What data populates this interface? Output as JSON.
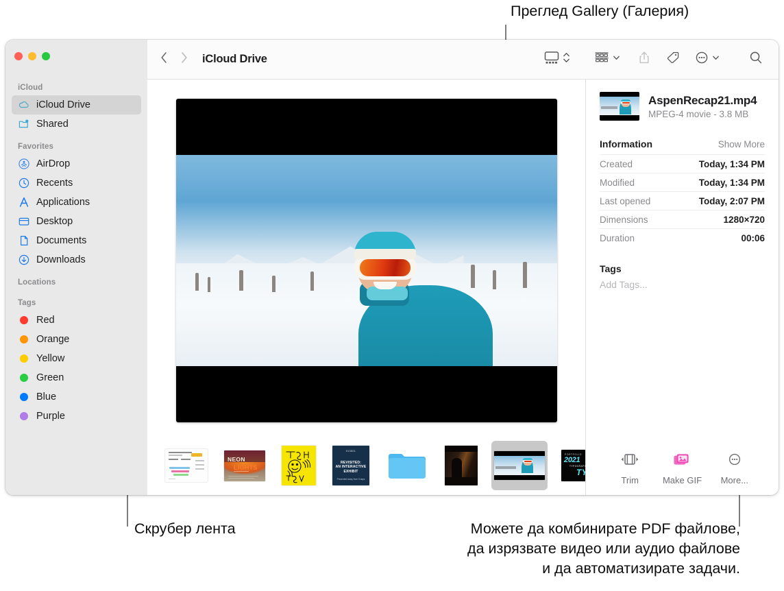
{
  "callouts": {
    "gallery": "Преглед Gallery (Галерия)",
    "scrubber": "Скрубер лента",
    "actions": "Можете да комбинирате PDF файлове,\nда изрязвате видео или аудио файлове\nи да автоматизирате задачи."
  },
  "window": {
    "traffic_lights": [
      "close",
      "minimize",
      "zoom"
    ]
  },
  "sidebar": {
    "groups": [
      {
        "title": "iCloud",
        "items": [
          {
            "label": "iCloud Drive",
            "icon": "cloud-icon",
            "selected": true
          },
          {
            "label": "Shared",
            "icon": "shared-folder-icon",
            "selected": false
          }
        ]
      },
      {
        "title": "Favorites",
        "items": [
          {
            "label": "AirDrop",
            "icon": "airdrop-icon",
            "selected": false
          },
          {
            "label": "Recents",
            "icon": "clock-icon",
            "selected": false
          },
          {
            "label": "Applications",
            "icon": "applications-icon",
            "selected": false
          },
          {
            "label": "Desktop",
            "icon": "desktop-icon",
            "selected": false
          },
          {
            "label": "Documents",
            "icon": "document-icon",
            "selected": false
          },
          {
            "label": "Downloads",
            "icon": "downloads-icon",
            "selected": false
          }
        ]
      },
      {
        "title": "Locations",
        "items": []
      },
      {
        "title": "Tags",
        "items": [
          {
            "label": "Red",
            "icon": "tag-dot-icon",
            "color": "#ff3b30"
          },
          {
            "label": "Orange",
            "icon": "tag-dot-icon",
            "color": "#ff9500"
          },
          {
            "label": "Yellow",
            "icon": "tag-dot-icon",
            "color": "#ffcc00"
          },
          {
            "label": "Green",
            "icon": "tag-dot-icon",
            "color": "#28cd41"
          },
          {
            "label": "Blue",
            "icon": "tag-dot-icon",
            "color": "#007aff"
          },
          {
            "label": "Purple",
            "icon": "tag-dot-icon",
            "color": "#af7ce8"
          }
        ]
      }
    ]
  },
  "toolbar": {
    "back": "back-icon",
    "forward": "forward-icon",
    "title": "iCloud Drive",
    "view_button": "gallery-view-icon",
    "group_button": "group-by-icon",
    "share_button": "share-icon",
    "tag_button": "tag-icon",
    "more_button": "more-actions-icon",
    "search_button": "search-icon"
  },
  "preview": {
    "alt": "Skier in teal jacket with white goggles on snowy mountain"
  },
  "scrubber": {
    "items": [
      {
        "name": "chart-document-thumbnail",
        "kind": "chart",
        "selected": false
      },
      {
        "name": "neon-lights-poster-thumbnail",
        "kind": "neon",
        "selected": false
      },
      {
        "name": "thank-you-poster-thumbnail",
        "kind": "thanks",
        "selected": false
      },
      {
        "name": "portfolio-exhibit-thumbnail",
        "kind": "portfolio",
        "selected": false
      },
      {
        "name": "folder-thumbnail",
        "kind": "folder",
        "selected": false
      },
      {
        "name": "dark-photo-thumbnail",
        "kind": "dark",
        "selected": false
      },
      {
        "name": "aspen-recap-video-thumbnail",
        "kind": "video",
        "selected": true
      },
      {
        "name": "typography-2021-thumbnail",
        "kind": "type",
        "selected": false
      },
      {
        "name": "gold-bells-photo-thumbnail",
        "kind": "gold",
        "selected": false
      }
    ]
  },
  "info": {
    "file_name": "AspenRecap21.mp4",
    "file_meta": "MPEG-4 movie - 3.8 MB",
    "section_title": "Information",
    "show_more": "Show More",
    "rows": [
      {
        "key": "Created",
        "value": "Today, 1:34 PM"
      },
      {
        "key": "Modified",
        "value": "Today, 1:34 PM"
      },
      {
        "key": "Last opened",
        "value": "Today, 2:07 PM"
      },
      {
        "key": "Dimensions",
        "value": "1280×720"
      },
      {
        "key": "Duration",
        "value": "00:06"
      }
    ],
    "tags_title": "Tags",
    "add_tags_placeholder": "Add Tags...",
    "actions": [
      {
        "label": "Trim",
        "icon": "trim-icon"
      },
      {
        "label": "Make GIF",
        "icon": "make-gif-icon"
      },
      {
        "label": "More...",
        "icon": "more-circle-icon"
      }
    ]
  },
  "colors": {
    "sidebar_bg": "#e9e9e9",
    "selection": "#d4d4d4",
    "accent_blue": "#007aff",
    "gif_pink": "#ef4bb4"
  }
}
